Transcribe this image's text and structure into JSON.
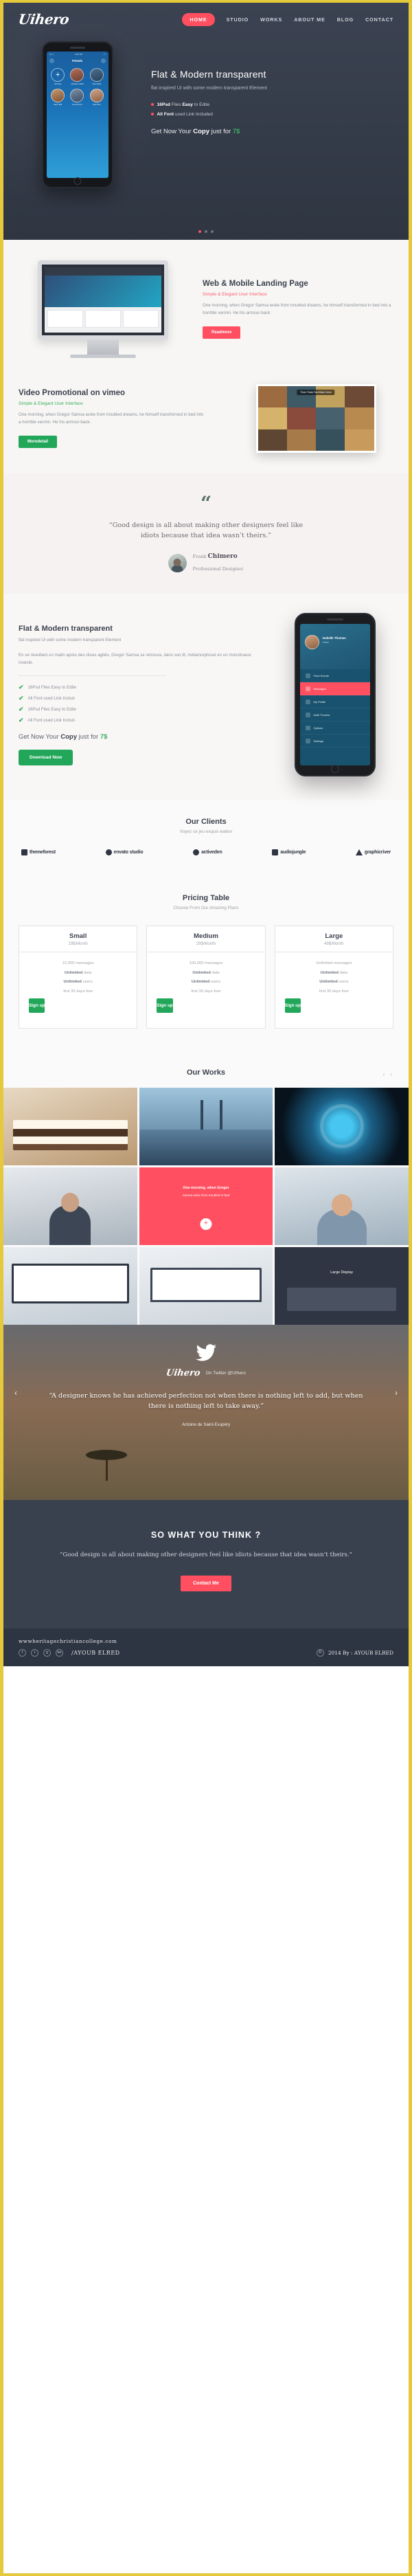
{
  "header": {
    "logo": "Uihero",
    "nav": [
      {
        "label": "HOME",
        "active": true
      },
      {
        "label": "STUDIO",
        "active": false
      },
      {
        "label": "WORKS",
        "active": false
      },
      {
        "label": "ABOUT ME",
        "active": false
      },
      {
        "label": "BLOG",
        "active": false
      },
      {
        "label": "CONTACT",
        "active": false
      }
    ]
  },
  "hero": {
    "title": "Flat & Modern transparent",
    "subtitle": "flat inspired UI with some modern transparent Element",
    "bullets": [
      {
        "strong": "16Psd",
        "mid": " Files ",
        "strong2": "Easy",
        "rest": " to Edite"
      },
      {
        "strong": "All",
        "mid": " ",
        "strong2": "Font",
        "rest": " used Link Included"
      }
    ],
    "cta_pre": "Get Now Your ",
    "cta_strong": "Copy",
    "cta_mid": " just for ",
    "cta_price": "7$",
    "phone": {
      "time": "9:00 AM",
      "title": "Friends",
      "contacts": [
        {
          "name": "Add New"
        },
        {
          "name": "Charlotte Collins"
        },
        {
          "name": "Tyler Webb"
        },
        {
          "name": "Aaron Bell"
        },
        {
          "name": "Emma Scott"
        },
        {
          "name": "Jack Price"
        }
      ]
    },
    "slider_dots": 3
  },
  "web_mobile": {
    "title": "Web & Mobile Landing Page",
    "lead": "Simple & Elegant User Interface",
    "body": "One morning, when Gregor Samsa woke from troubled dreams, he himself transformed in bed into a horrible vermin. He  his armour-back.",
    "button": "Readmore"
  },
  "video": {
    "title": "Video Promotional on vimeo",
    "lead": "Simple & Elegant User Interface",
    "body": "One morning, when Gregor Samsa woke from troubled dreams, he himself transformed in bed into a horrible vermin. He  his armour-back.",
    "button": "Moredetail",
    "thumb_label": "Three Times Fast Bloke Verse"
  },
  "testimonial": {
    "quote_mark": "“",
    "quote": "“Good design is all about making other designers feel like idiots because that idea wasn’t theirs.”",
    "name_first": "Frank ",
    "name_last": "Chimero",
    "role": "Professional Designer."
  },
  "features": {
    "title": "Flat & Modern transparent",
    "subtitle": "flat inspired UI with some modern transparent Element",
    "body": "En se réveillant un matin après des rêves agités, Gregor Samsa se retrouva, dans son lit, métamorphosé en un monstrueux insecte.",
    "checks": [
      "16Psd Files Easy to Edite",
      "All Font used Link Includ-",
      "16Psd Files Easy to Edite",
      "All Font used Link Includ-"
    ],
    "cta_pre": "Get Now Your ",
    "cta_strong": "Copy",
    "cta_mid": " just for ",
    "cta_price": "7$",
    "button": "Download Now",
    "phone": {
      "user": "Isabelle Thomas",
      "status": "Online",
      "items": [
        "Feed Events",
        "Messages",
        "My Profile",
        "Multi Thumbs",
        "Options",
        "Settings"
      ],
      "highlight_index": 1
    }
  },
  "clients": {
    "title": "Our Clients",
    "subtitle": "Voyez ce jeu exquis wallon",
    "logos": [
      "themeforest",
      "envato studio",
      "activeden",
      "audiojungle",
      "graphicriver"
    ]
  },
  "pricing": {
    "title": "Pricing Table",
    "subtitle": "Choose From Our Amazing Plans",
    "plans": [
      {
        "name": "Small",
        "price": "19$/Month",
        "features": [
          {
            "strong": "",
            "text": "10,000 messages"
          },
          {
            "strong": "Unlimited",
            "text": " data"
          },
          {
            "strong": "Unlimited",
            "text": " users"
          },
          {
            "strong": "",
            "text": "first 30 days free"
          }
        ],
        "button": "Sign up"
      },
      {
        "name": "Medium",
        "price": "29$/Month",
        "features": [
          {
            "strong": "",
            "text": "100,000 messages"
          },
          {
            "strong": "Unlimited",
            "text": " data"
          },
          {
            "strong": "Unlimited",
            "text": " users"
          },
          {
            "strong": "",
            "text": "first 30 days free"
          }
        ],
        "button": "Sign up"
      },
      {
        "name": "Large",
        "price": "49$/Month",
        "features": [
          {
            "strong": "",
            "text": "Unlimited messages"
          },
          {
            "strong": "Unlimited",
            "text": " data"
          },
          {
            "strong": "Unlimited",
            "text": " users"
          },
          {
            "strong": "",
            "text": "first 30 days free"
          }
        ],
        "button": "Sign up"
      }
    ]
  },
  "works": {
    "title": "Our Works",
    "prev": "‹",
    "next": "›",
    "tiles": [
      {
        "name": "cake-photo",
        "caption": ""
      },
      {
        "name": "bridge-photo",
        "caption": ""
      },
      {
        "name": "lens-photo",
        "caption": ""
      },
      {
        "name": "man-laptop-photo",
        "caption": ""
      },
      {
        "name": "red-overlay-card",
        "caption_title": "One morning, when Gregor",
        "caption_body": "Samsa woke from troubled in bed",
        "plus": "+"
      },
      {
        "name": "glasses-man-photo",
        "caption": ""
      },
      {
        "name": "browser-mockup",
        "caption": ""
      },
      {
        "name": "macbook-mockup",
        "caption": ""
      },
      {
        "name": "large-display-card",
        "caption": "Large Display"
      }
    ]
  },
  "twitter": {
    "bird": "🐦",
    "logo": "Uihero",
    "handle": "On Twitter @UIhero",
    "quote": "“A designer knows he has achieved perfection not when there is nothing left to add, but when there is nothing left to take away.”",
    "author": "Antoine de Saint-Exupéry",
    "prev": "‹",
    "next": "›"
  },
  "cta": {
    "title": "SO WHAT YOU THINK ?",
    "quote": "“Good design is all about making other designers feel like idiots because that idea wasn’t theirs.”",
    "button": "Contact Me"
  },
  "footer": {
    "url": "wwwheritagechristiancollege.com",
    "social": [
      "f",
      "t",
      "g",
      "be"
    ],
    "name": "/AYOUB ELRED",
    "copyright_mark": "©",
    "copyright": "2014  By : AYOUB ELRED"
  },
  "colors": {
    "accent_pink": "#ff4f61",
    "accent_green": "#22a75a",
    "dark": "#39414f",
    "border_yellow": "#e3c93b"
  }
}
